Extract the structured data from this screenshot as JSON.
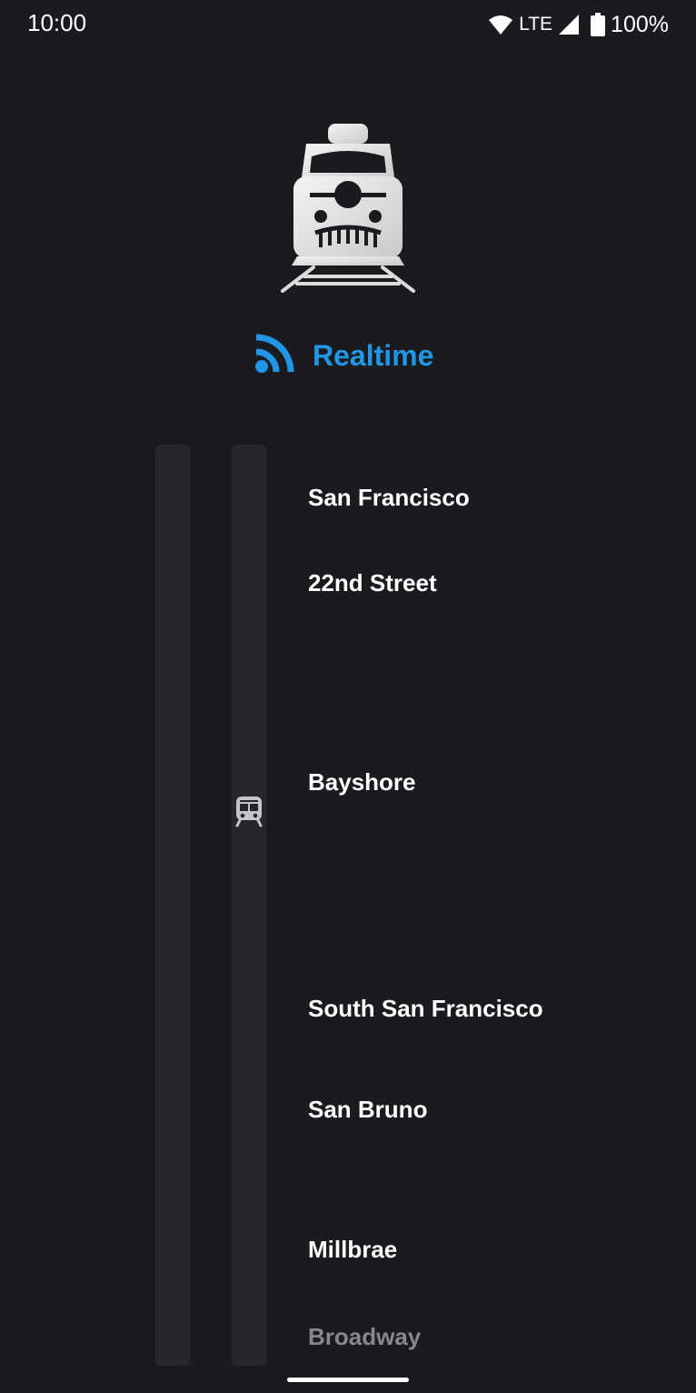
{
  "status_bar": {
    "time": "10:00",
    "network": "LTE",
    "battery": "100%",
    "icons": [
      "wifi-icon",
      "cell-signal-icon",
      "battery-icon"
    ]
  },
  "header": {
    "logo_icon": "train-front-icon",
    "feed_icon": "rss-feed-icon",
    "title": "Realtime",
    "accent_color": "#2196e6"
  },
  "route": {
    "vehicle_icon": "train-icon",
    "stops": [
      {
        "name": "San Francisco"
      },
      {
        "name": "22nd Street"
      },
      {
        "name": "Bayshore"
      },
      {
        "name": "South San Francisco"
      },
      {
        "name": "San Bruno"
      },
      {
        "name": "Millbrae"
      },
      {
        "name": "Broadway"
      }
    ]
  }
}
